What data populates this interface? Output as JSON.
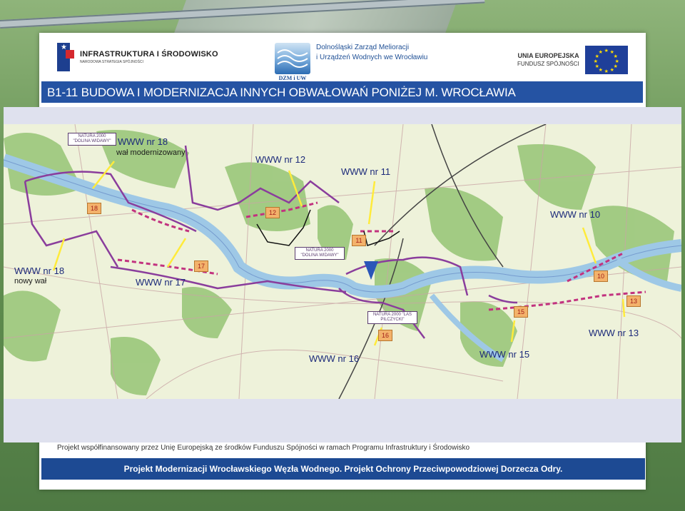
{
  "header": {
    "logo_left": {
      "title": "INFRASTRUKTURA I ŚRODOWISKO",
      "subtitle": "NARODOWA STRATEGIA SPÓJNOŚCI"
    },
    "logo_center": {
      "line1": "Dolnośląski Zarząd Melioracji",
      "line2": "i Urządzeń Wodnych we Wrocławiu",
      "caption": "DZM i UW"
    },
    "logo_right": {
      "line1": "UNIA EUROPEJSKA",
      "line2": "FUNDUSZ SPÓJNOŚCI"
    }
  },
  "title": "B1-11 BUDOWA I MODERNIZACJA INNYCH OBWAŁOWAŃ PONIŻEJ  M. WROCŁAWIA",
  "map": {
    "labels": {
      "www18_mod": "WWW nr 18",
      "www18_mod_sub": "wał modernizowany",
      "www12": "WWW nr 12",
      "www11": "WWW nr 11",
      "www10": "WWW nr 10",
      "www18_new": "WWW nr 18",
      "www18_new_sub": "nowy wał",
      "www17": "WWW nr 17",
      "www13": "WWW nr 13",
      "www16": "WWW nr 16",
      "www15": "WWW nr 15"
    },
    "number_markers": {
      "n18": "18",
      "n12": "12",
      "n11": "11",
      "n17": "17",
      "n10": "10",
      "n15": "15",
      "n13": "13",
      "n16": "16"
    },
    "natura_boxes": {
      "dolina_widawy_1": "NATURA 2000 \"DOLINA WIDAWY\"",
      "dolina_widawy_2": "NATURA 2000 \"DOLINA WIDAWY\"",
      "las_pilczycki": "NATURA 2000 \"LAS PILCZYCKI\""
    }
  },
  "footer": {
    "note": "Projekt współfinansowany przez Unię Europejską ze środków Funduszu Spójności w ramach Programu Infrastruktury i Środowisko",
    "banner": "Projekt Modernizacji Wrocławskiego Węzła Wodnego. Projekt Ochrony Przeciwpowodziowej Dorzecza Odry."
  },
  "colors": {
    "title_bar": "#2553a3",
    "footer_bar": "#1d4a93",
    "river": "#a8cde8",
    "forest": "#8fbf6e",
    "dike_purple": "#8a3d9c",
    "dike_magenta": "#c2327f",
    "callout_yellow": "#ffeb3b"
  }
}
